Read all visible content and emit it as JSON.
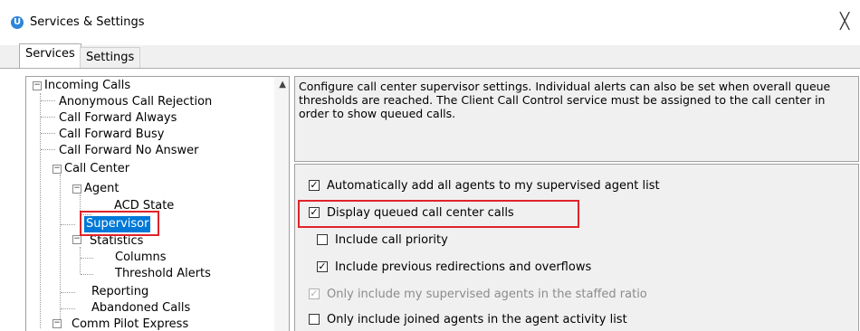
{
  "window": {
    "title": "Services & Settings",
    "app_icon": "U",
    "close_glyph": "╳"
  },
  "tabs": [
    {
      "label": "Services",
      "active": true
    },
    {
      "label": "Settings",
      "active": false
    }
  ],
  "tree": {
    "items": [
      {
        "label": "Incoming Calls"
      },
      {
        "label": "Anonymous Call Rejection"
      },
      {
        "label": "Call Forward Always"
      },
      {
        "label": "Call Forward Busy"
      },
      {
        "label": "Call Forward No Answer"
      },
      {
        "label": "Call Center"
      },
      {
        "label": "Agent"
      },
      {
        "label": "ACD State"
      },
      {
        "label": "Supervisor",
        "selected": true
      },
      {
        "label": "Statistics"
      },
      {
        "label": "Columns"
      },
      {
        "label": "Threshold Alerts"
      },
      {
        "label": "Reporting"
      },
      {
        "label": "Abandoned Calls"
      },
      {
        "label": "Comm Pilot Express"
      }
    ],
    "expander_glyph": "−"
  },
  "description": {
    "text": "Configure call center supervisor settings.  Individual alerts can also be set when overall queue thresholds are reached.  The Client Call Control service must be assigned to the call center in order to show queued calls."
  },
  "options": [
    {
      "label": "Automatically add all agents to my supervised agent list",
      "checked": true,
      "enabled": true
    },
    {
      "label": "Display queued call center calls",
      "checked": true,
      "enabled": true
    },
    {
      "label": "Include call priority",
      "checked": false,
      "enabled": true
    },
    {
      "label": "Include previous redirections and overflows",
      "checked": true,
      "enabled": true
    },
    {
      "label": "Only include my supervised agents in the staffed ratio",
      "checked": true,
      "enabled": false
    },
    {
      "label": "Only include joined agents in the agent activity list",
      "checked": false,
      "enabled": true
    }
  ],
  "colors": {
    "selection": "#0078d7",
    "highlight_box": "#e0242a",
    "panel_bg": "#f0f0f0"
  }
}
